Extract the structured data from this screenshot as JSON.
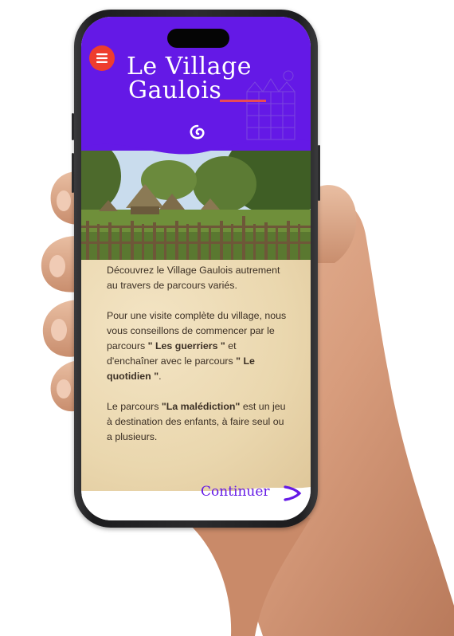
{
  "app": {
    "title_line1": "Le Village",
    "title_line2": "Gaulois"
  },
  "header": {
    "menu_icon": "hamburger-menu-icon",
    "logo_icon": "spiral-logo-icon",
    "background_color": "#6419e6",
    "accent_color": "#ee3d2d"
  },
  "intro": {
    "p1": "Découvrez le Village Gaulois autrement au travers de parcours variés.",
    "p2_a": "Pour une visite complète du village, nous vous conseillons de commencer par le parcours ",
    "p2_b1": "\" Les guerriers \"",
    "p2_c": " et d'enchaîner avec le parcours ",
    "p2_b2": "\" Le quotidien \"",
    "p2_d": ".",
    "p3_a": "Le parcours ",
    "p3_b": "\"La malédiction\"",
    "p3_c": " est un jeu à destination des enfants, à faire seul ou a plusieurs."
  },
  "footer": {
    "continue_label": "Continuer",
    "continue_icon": "chevron-arrow-right-icon"
  }
}
